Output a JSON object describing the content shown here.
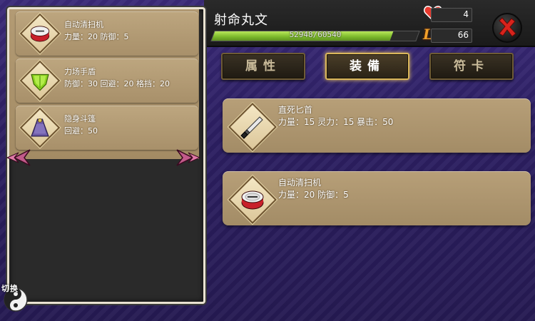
{
  "header": {
    "character_name": "射命丸文",
    "exp_text": "52948/60540",
    "exp_fraction": 0.8746,
    "hp_value": "4",
    "level_label": "Lv",
    "level_value": "66"
  },
  "tabs": [
    {
      "label": "属性",
      "active": false
    },
    {
      "label": "装備",
      "active": true
    },
    {
      "label": "符卡",
      "active": false
    }
  ],
  "equipped": [
    {
      "name": "直死匕首",
      "stats": "力量：15 灵力：15 暴击：50",
      "icon": "dagger-icon"
    },
    {
      "name": "自动清扫机",
      "stats": "力量：20 防御：5",
      "icon": "drum-icon"
    }
  ],
  "inventory": [
    {
      "name": "自动清扫机",
      "stats": "力量：20 防御：5",
      "icon": "drum-icon"
    },
    {
      "name": "力场手盾",
      "stats": "防御：30 回避：20 格挡：20",
      "icon": "green-shield-icon"
    },
    {
      "name": "隐身斗篷",
      "stats": "回避：50",
      "icon": "cloak-icon"
    }
  ],
  "switch_label": "切换",
  "colors": {
    "exp_fill": "#8fcf3a",
    "accent_gold": "#d9b65a",
    "close_red": "#d8231c"
  }
}
